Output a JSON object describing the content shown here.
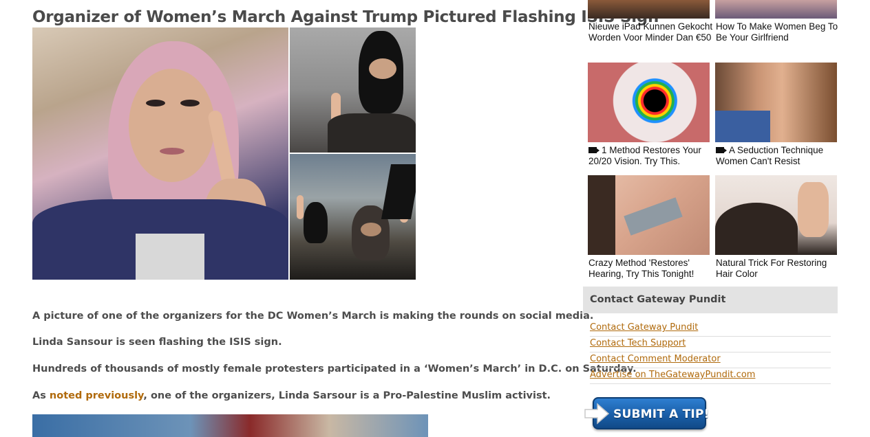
{
  "article": {
    "title": "Organizer of Women’s March Against Trump Pictured Flashing ISIS Sign",
    "paragraphs": {
      "p1": "A picture of one of the organizers for the DC Women’s March is making the rounds on social media.",
      "p2": "Linda Sansour is seen flashing the ISIS sign.",
      "p3": "Hundreds of thousands of mostly female protesters participated in a ‘Women’s March’ in D.C. on Saturday.",
      "p4_prefix": "As ",
      "p4_link": "noted previously",
      "p4_suffix": ", one of the organizers, Linda Sarsour is a Pro-Palestine Muslim activist."
    }
  },
  "ads": [
    {
      "text": "Nieuwe iPad Kunnen Gekocht Worden Voor Minder Dan €50",
      "video": false
    },
    {
      "text": "How To Make Women Beg To Be Your Girlfriend",
      "video": false
    },
    {
      "text": "1 Method Restores Your 20/20 Vision. Try This.",
      "video": true
    },
    {
      "text": "A Seduction Technique Women Can't Resist",
      "video": true
    },
    {
      "text": "Crazy Method 'Restores' Hearing, Try This Tonight!",
      "video": false
    },
    {
      "text": "Natural Trick For Restoring Hair Color",
      "video": false
    }
  ],
  "contact": {
    "heading": "Contact Gateway Pundit",
    "links": [
      "Contact Gateway Pundit",
      "Contact Tech Support",
      "Contact Comment Moderator",
      "Advertise on TheGatewayPundit.com"
    ]
  },
  "tip_button": {
    "label": "SUBMIT A TIP!"
  },
  "colors": {
    "link": "#b06a0c",
    "title": "#4a4a4a",
    "tip_button": "#1a5ea8"
  }
}
